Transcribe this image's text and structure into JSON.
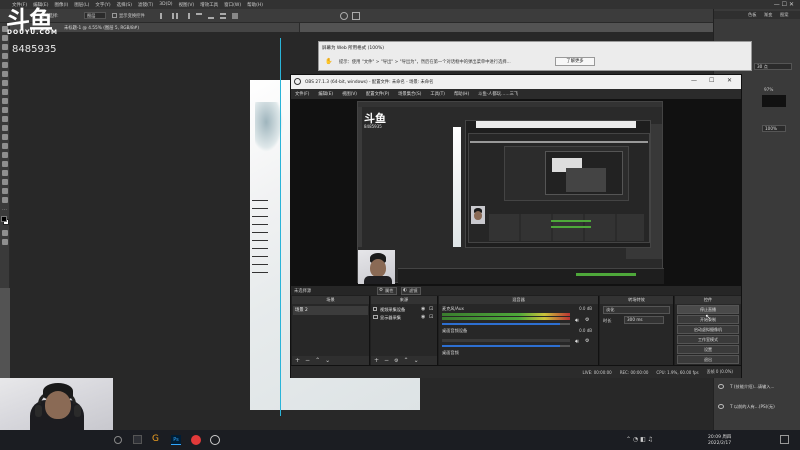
{
  "photoshop": {
    "menu": [
      "文件(F)",
      "编辑(E)",
      "图像(I)",
      "图层(L)",
      "文字(Y)",
      "选择(S)",
      "滤镜(T)",
      "3D(D)",
      "视图(V)",
      "增效工具",
      "窗口(W)",
      "帮助(H)"
    ],
    "options": {
      "auto_select_label": "自动选择:",
      "auto_select_value": "图层",
      "show_transform_label": "显示变换控件"
    },
    "doc_tab": "未标题-1 @ 4.55% (图层 5, RGB/8#)",
    "stream_id": "8485935",
    "right_tabs": [
      "色板",
      "渐变",
      "图案"
    ],
    "right_values": {
      "font_size": "30 点",
      "percent": "97%",
      "opacity": "100%"
    },
    "layers": [
      {
        "label": "T (技能介绍)...请输入..."
      },
      {
        "label": "T 以前的人有...(PS)(无)"
      }
    ]
  },
  "watermark": {
    "logo": "斗鱼",
    "site": "DOUYU.COM"
  },
  "ie_banner": {
    "title": "屏幕为 Web 所用格式 (100%)",
    "message": "提示：使用 \"文件\" > \"导出\" > \"导出为\"，然后在第一个对话框中的弹出菜单中进行选择...",
    "button": "了解更多"
  },
  "obs": {
    "title": "OBS 27.1.3 (64-bit, windows) - 配置文件: 未命名 - 场景: 未命名",
    "menu": [
      "文件(F)",
      "编辑(E)",
      "视图(V)",
      "配置文件(P)",
      "场景集合(S)",
      "工具(T)",
      "帮助(H)",
      "斗鱼·人都玩……三飞"
    ],
    "source_toolbar": {
      "no_source": "未选择源",
      "properties": "属性",
      "filters": "滤镜"
    },
    "docks": {
      "scenes": {
        "title": "场景",
        "items": [
          "场景 2"
        ]
      },
      "sources": {
        "title": "来源",
        "items": [
          "视频采集设备",
          "显示器采集"
        ]
      },
      "mixer": {
        "title": "混音器",
        "channels": [
          {
            "name": "麦克风/Aux",
            "db": "0.0 dB"
          },
          {
            "name": "桌面音频设备",
            "db": "0.0 dB"
          },
          {
            "name": "桌面音频",
            "db": ""
          }
        ]
      },
      "transitions": {
        "title": "转场特效",
        "type": "淡化",
        "duration_label": "时长",
        "duration_value": "300 ms"
      },
      "controls": {
        "title": "控件",
        "buttons": [
          "停止直播",
          "开始录制",
          "启动虚拟摄像机",
          "工作室模式",
          "设置",
          "退出"
        ]
      }
    },
    "status": {
      "live": "LIVE: 00:00:00",
      "rec": "REC: 00:00:00",
      "cpu": "CPU: 1.9%, 60.00 fps",
      "dropped": "丢帧 0 (0.0%)"
    }
  },
  "taskbar": {
    "time": "20:09 周四",
    "date": "2022/2/17"
  }
}
